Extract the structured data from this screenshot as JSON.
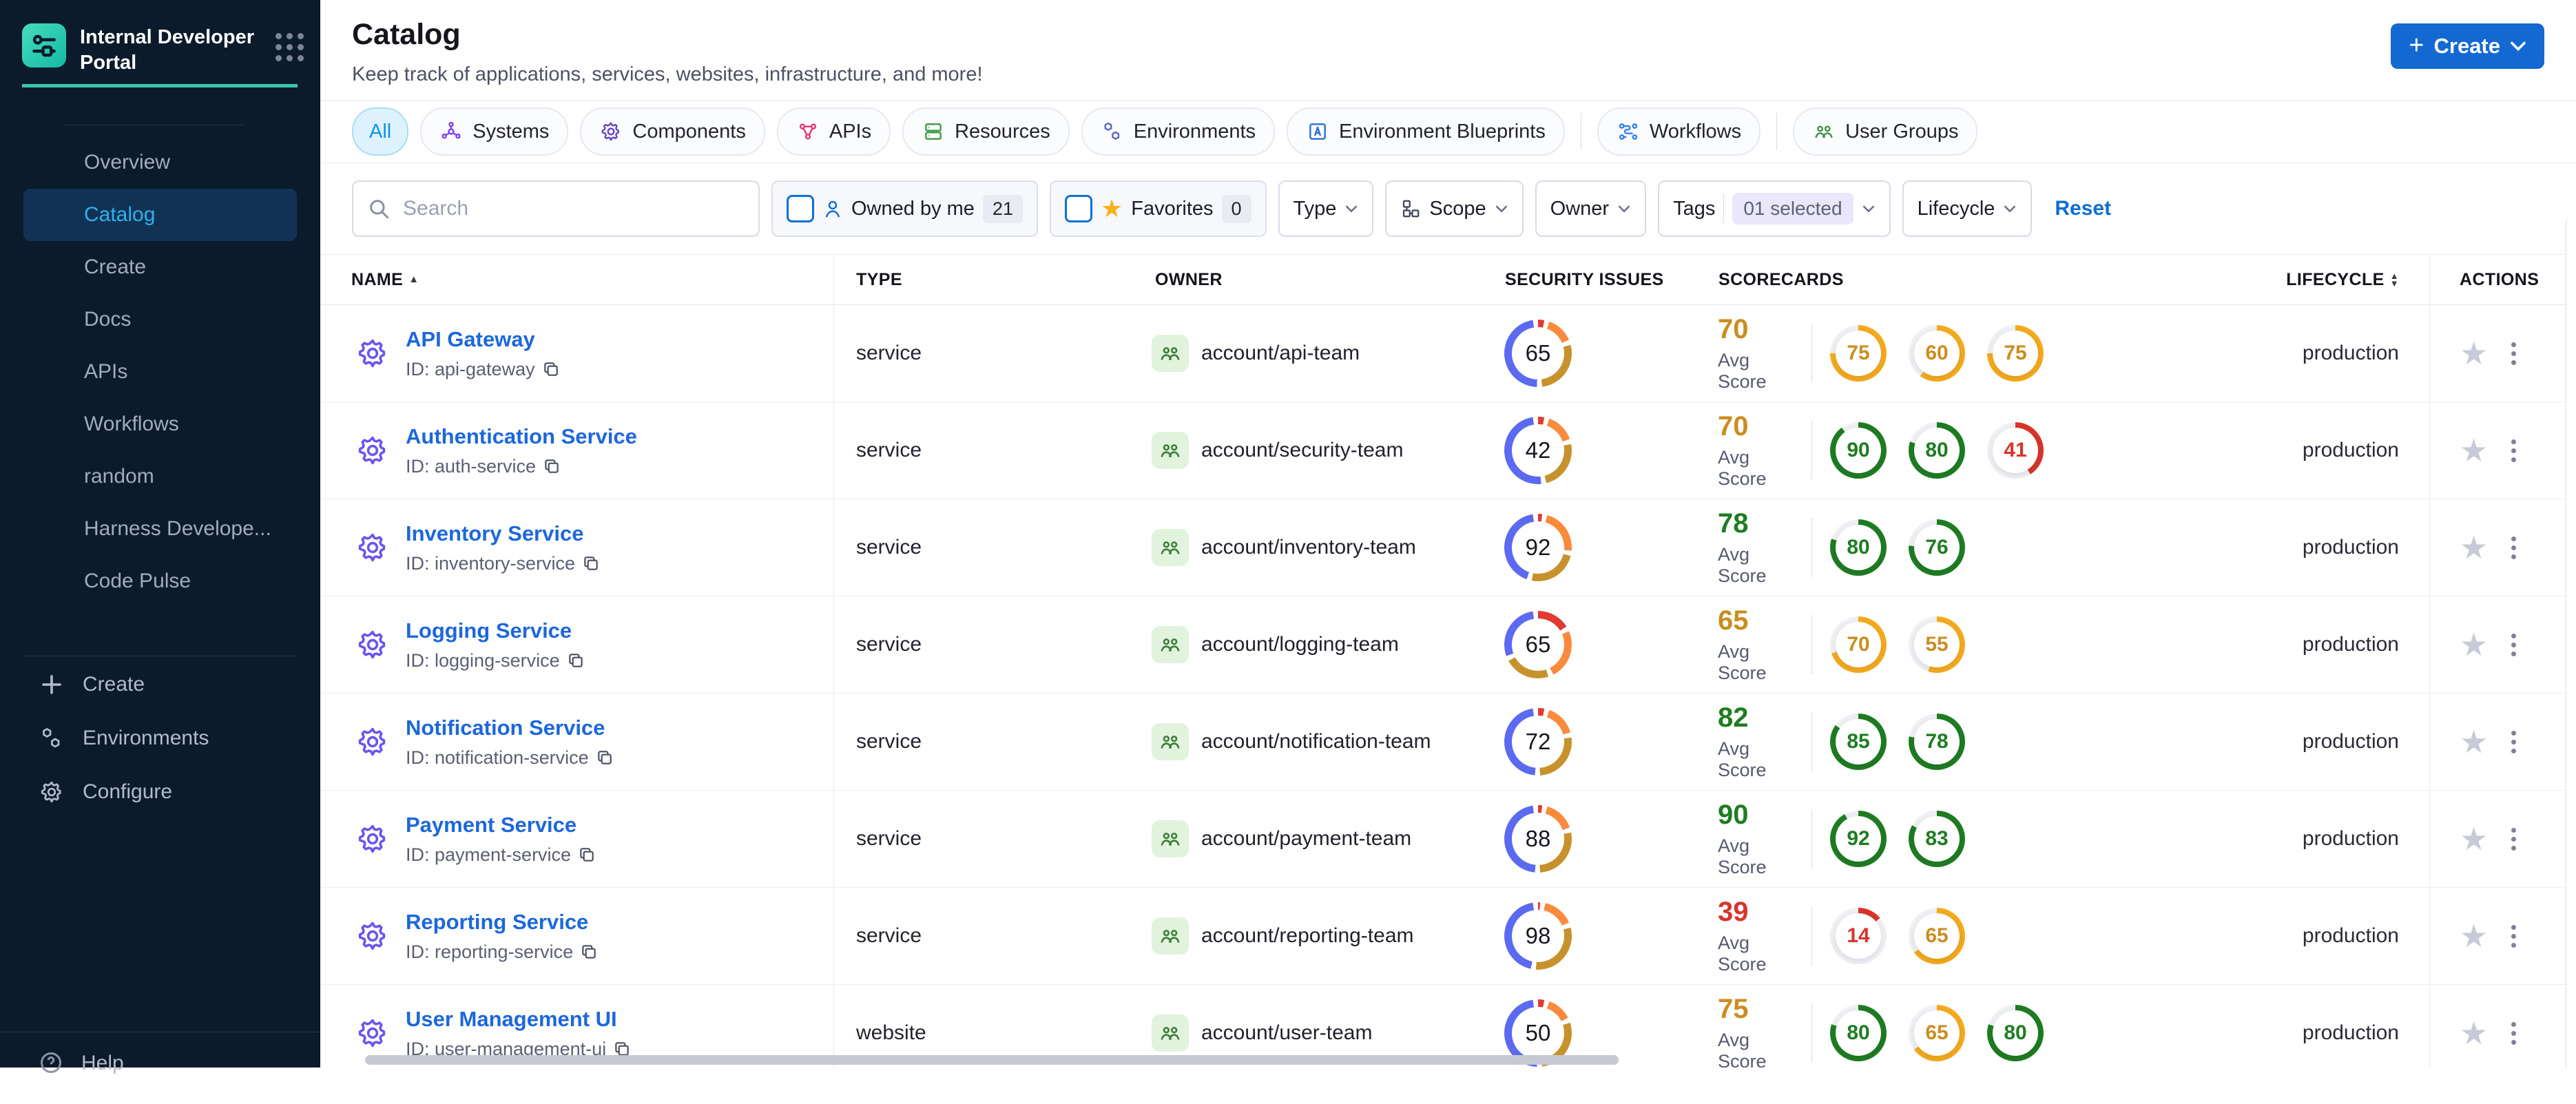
{
  "colors": {
    "sidebar_bg": "#0b1b2c",
    "accent_teal": "#3ec6ad",
    "primary_blue": "#1468d2",
    "link_blue": "#1c67dd",
    "active_nav_text": "#29b2f1"
  },
  "sidebar": {
    "title": "Internal Developer Portal",
    "nav": [
      {
        "label": "Overview",
        "active": false
      },
      {
        "label": "Catalog",
        "active": true
      },
      {
        "label": "Create",
        "active": false
      },
      {
        "label": "Docs",
        "active": false
      },
      {
        "label": "APIs",
        "active": false
      },
      {
        "label": "Workflows",
        "active": false
      },
      {
        "label": "random",
        "active": false
      },
      {
        "label": "Harness Develope...",
        "active": false
      },
      {
        "label": "Code Pulse",
        "active": false
      }
    ],
    "bottom": [
      {
        "icon": "plus",
        "label": "Create"
      },
      {
        "icon": "environments",
        "label": "Environments"
      },
      {
        "icon": "gear",
        "label": "Configure"
      }
    ],
    "help_label": "Help"
  },
  "header": {
    "title": "Catalog",
    "subtitle": "Keep track of applications, services, websites, infrastructure, and more!",
    "create_button": "Create"
  },
  "tabs": [
    {
      "label": "All",
      "active": true,
      "icon": "",
      "color": "",
      "sep_after": false
    },
    {
      "label": "Systems",
      "active": false,
      "icon": "systems",
      "color": "#7d3ff2",
      "sep_after": false
    },
    {
      "label": "Components",
      "active": false,
      "icon": "gear",
      "color": "#6746c3",
      "sep_after": false
    },
    {
      "label": "APIs",
      "active": false,
      "icon": "apis",
      "color": "#e0356f",
      "sep_after": false
    },
    {
      "label": "Resources",
      "active": false,
      "icon": "resources",
      "color": "#3d9a43",
      "sep_after": false
    },
    {
      "label": "Environments",
      "active": false,
      "icon": "environments",
      "color": "#5a68c9",
      "sep_after": false
    },
    {
      "label": "Environment Blueprints",
      "active": false,
      "icon": "blueprint",
      "color": "#2a6fd3",
      "sep_after": true
    },
    {
      "label": "Workflows",
      "active": false,
      "icon": "workflows",
      "color": "#2f80ed",
      "sep_after": true
    },
    {
      "label": "User Groups",
      "active": false,
      "icon": "usergroups",
      "color": "#3f8f45",
      "sep_after": false
    }
  ],
  "filters": {
    "search_placeholder": "Search",
    "owned_by_me": {
      "label": "Owned by me",
      "count": "21"
    },
    "favorites": {
      "label": "Favorites",
      "count": "0"
    },
    "type_label": "Type",
    "scope_label": "Scope",
    "owner_label": "Owner",
    "tags_label": "Tags",
    "tags_value": "01 selected",
    "lifecycle_label": "Lifecycle",
    "reset_label": "Reset"
  },
  "table": {
    "headers": {
      "name": "NAME",
      "type": "TYPE",
      "owner": "OWNER",
      "security": "SECURITY ISSUES",
      "scorecards": "SCORECARDS",
      "lifecycle": "LIFECYCLE",
      "actions": "ACTIONS"
    },
    "avg_score_label": "Avg Score",
    "rows": [
      {
        "name": "API Gateway",
        "id": "ID: api-gateway",
        "type": "service",
        "owner": "account/api-team",
        "security": 65,
        "security_segments": {
          "red": 3,
          "orange": 13,
          "yellow": 27,
          "blue": 47
        },
        "avg": 70,
        "avg_color": "orange",
        "scorecards": [
          {
            "value": 75,
            "color": "orange"
          },
          {
            "value": 60,
            "color": "orange"
          },
          {
            "value": 75,
            "color": "orange"
          }
        ],
        "lifecycle": "production"
      },
      {
        "name": "Authentication Service",
        "id": "ID: auth-service",
        "type": "service",
        "owner": "account/security-team",
        "security": 42,
        "security_segments": {
          "red": 3,
          "orange": 14,
          "yellow": 24,
          "blue": 49
        },
        "avg": 70,
        "avg_color": "orange",
        "scorecards": [
          {
            "value": 90,
            "color": "green"
          },
          {
            "value": 80,
            "color": "green"
          },
          {
            "value": 41,
            "color": "red"
          }
        ],
        "lifecycle": "production"
      },
      {
        "name": "Inventory Service",
        "id": "ID: inventory-service",
        "type": "service",
        "owner": "account/inventory-team",
        "security": 92,
        "security_segments": {
          "red": 2,
          "orange": 22,
          "yellow": 24,
          "blue": 42
        },
        "avg": 78,
        "avg_color": "green",
        "scorecards": [
          {
            "value": 80,
            "color": "green"
          },
          {
            "value": 76,
            "color": "green"
          }
        ],
        "lifecycle": "production"
      },
      {
        "name": "Logging Service",
        "id": "ID: logging-service",
        "type": "service",
        "owner": "account/logging-team",
        "security": 65,
        "security_segments": {
          "red": 16,
          "orange": 24,
          "yellow": 22,
          "blue": 28
        },
        "avg": 65,
        "avg_color": "orange",
        "scorecards": [
          {
            "value": 70,
            "color": "orange"
          },
          {
            "value": 55,
            "color": "orange"
          }
        ],
        "lifecycle": "production"
      },
      {
        "name": "Notification Service",
        "id": "ID: notification-service",
        "type": "service",
        "owner": "account/notification-team",
        "security": 72,
        "security_segments": {
          "red": 3,
          "orange": 15,
          "yellow": 26,
          "blue": 46
        },
        "avg": 82,
        "avg_color": "green",
        "scorecards": [
          {
            "value": 85,
            "color": "green"
          },
          {
            "value": 78,
            "color": "green"
          }
        ],
        "lifecycle": "production"
      },
      {
        "name": "Payment Service",
        "id": "ID: payment-service",
        "type": "service",
        "owner": "account/payment-team",
        "security": 88,
        "security_segments": {
          "red": 2,
          "orange": 15,
          "yellow": 27,
          "blue": 46
        },
        "avg": 90,
        "avg_color": "green",
        "scorecards": [
          {
            "value": 92,
            "color": "green"
          },
          {
            "value": 83,
            "color": "green"
          }
        ],
        "lifecycle": "production"
      },
      {
        "name": "Reporting Service",
        "id": "ID: reporting-service",
        "type": "service",
        "owner": "account/reporting-team",
        "security": 98,
        "security_segments": {
          "red": 1,
          "orange": 15,
          "yellow": 30,
          "blue": 44
        },
        "avg": 39,
        "avg_color": "red",
        "scorecards": [
          {
            "value": 14,
            "color": "red"
          },
          {
            "value": 65,
            "color": "orange"
          }
        ],
        "lifecycle": "production"
      },
      {
        "name": "User Management UI",
        "id": "ID: user-management-ui",
        "type": "website",
        "owner": "account/user-team",
        "security": 50,
        "security_segments": {
          "red": 3,
          "orange": 12,
          "yellow": 28,
          "blue": 47
        },
        "avg": 75,
        "avg_color": "orange",
        "scorecards": [
          {
            "value": 80,
            "color": "green"
          },
          {
            "value": 65,
            "color": "orange"
          },
          {
            "value": 80,
            "color": "green"
          }
        ],
        "lifecycle": "production"
      }
    ]
  },
  "score_palette": {
    "green": {
      "arc": "#1e7d21",
      "text": "#1e7d21"
    },
    "orange": {
      "arc": "#f6ab1d",
      "text": "#cb8d20"
    },
    "red": {
      "arc": "#d8352b",
      "text": "#d8352b"
    }
  },
  "donut_palette": {
    "red": "#e23a30",
    "orange": "#fb8a3c",
    "yellow": "#c7922c",
    "blue": "#5b6af0"
  }
}
